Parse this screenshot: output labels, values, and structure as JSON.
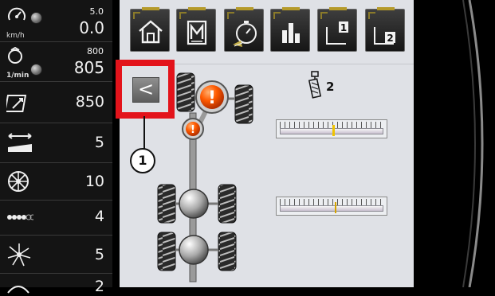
{
  "sidebar": {
    "speed": {
      "setpoint": "5.0",
      "value": "0.0",
      "unit": "km/h"
    },
    "engine": {
      "setpoint": "800",
      "value": "805",
      "unit": "1/min"
    },
    "rows": [
      {
        "icon": "area-counter-icon",
        "value": "850"
      },
      {
        "icon": "working-width-icon",
        "value": "5"
      },
      {
        "icon": "wheel-icon",
        "value": "10"
      },
      {
        "icon": "rows-icon",
        "value": "4"
      },
      {
        "icon": "rotor-icon",
        "value": "5"
      },
      {
        "icon": "partial-icon",
        "value": "2"
      }
    ]
  },
  "tabs": [
    {
      "name": "home",
      "icon": "home-icon"
    },
    {
      "name": "memory",
      "icon": "memory-m-icon"
    },
    {
      "name": "timer",
      "icon": "stopwatch-icon"
    },
    {
      "name": "statistics",
      "icon": "bar-chart-icon"
    },
    {
      "name": "page-1",
      "icon": "page-1-icon",
      "label": "1"
    },
    {
      "name": "page-2",
      "icon": "page-2-icon",
      "label": "2"
    }
  ],
  "main": {
    "back_label": "<",
    "spring_label": "2",
    "callout": "1",
    "gauges": [
      {
        "name": "upper-axle-gauge",
        "marker": 0.51,
        "color": "#f0c400"
      },
      {
        "name": "lower-axle-gauge",
        "marker": 0.53,
        "color": "#d6a400"
      }
    ],
    "warnings": [
      {
        "name": "warning-large-icon",
        "glyph": "!"
      },
      {
        "name": "warning-small-icon",
        "glyph": "!"
      }
    ]
  },
  "colors": {
    "highlight": "#e3131b",
    "warning": "#ff6a00",
    "panel": "#dfe1e6"
  }
}
